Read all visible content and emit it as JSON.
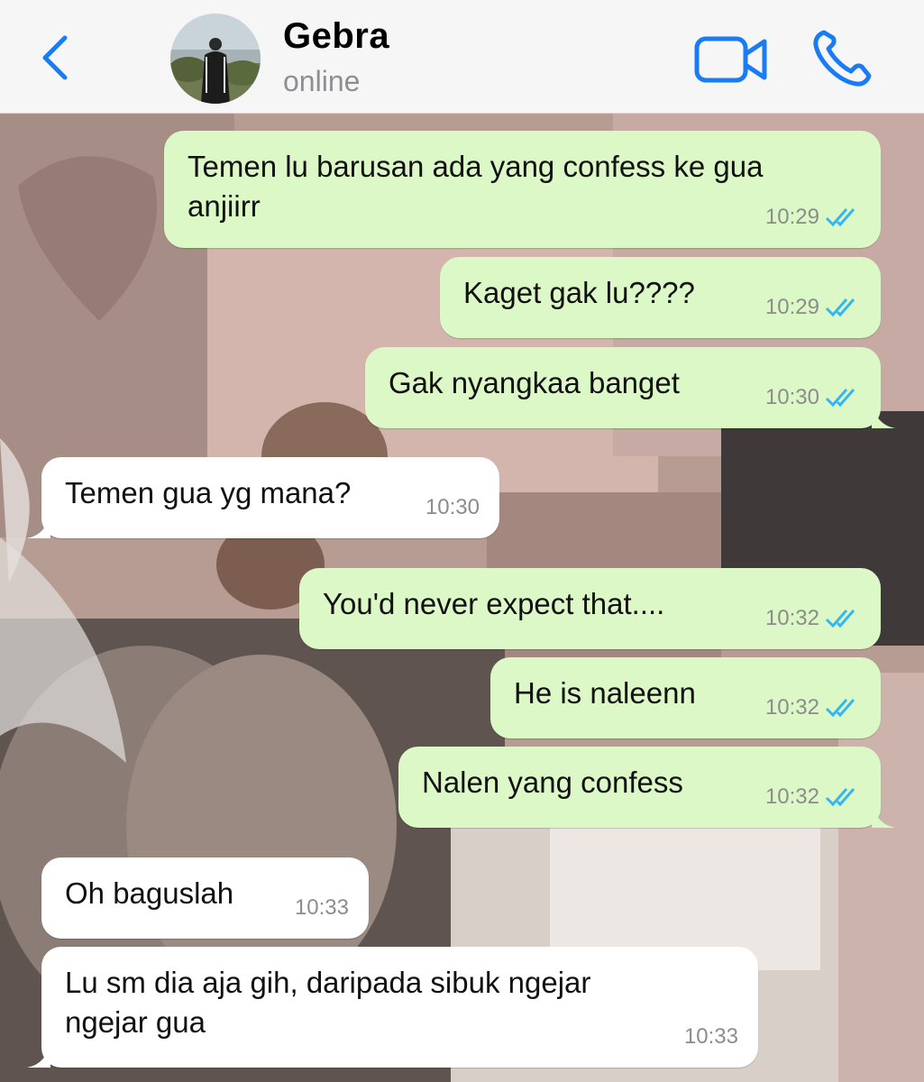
{
  "header": {
    "contact_name": "Gebra",
    "status": "online",
    "accent_color": "#1a7cf5"
  },
  "icons": {
    "back": "chevron-left-icon",
    "video": "video-camera-icon",
    "call": "phone-icon",
    "read": "double-check-icon"
  },
  "colors": {
    "outgoing_bubble": "#dcf8c6",
    "incoming_bubble": "#ffffff",
    "read_ticks": "#34b7f1"
  },
  "messages": [
    {
      "direction": "out",
      "lines": [
        "Temen lu barusan ada yang confess ke gua",
        "anjiirr"
      ],
      "time": "10:29",
      "status": "read"
    },
    {
      "direction": "out",
      "lines": [
        "Kaget gak lu????"
      ],
      "time": "10:29",
      "status": "read"
    },
    {
      "direction": "out",
      "lines": [
        "Gak nyangkaa banget"
      ],
      "time": "10:30",
      "status": "read"
    },
    {
      "direction": "in",
      "lines": [
        "Temen gua yg mana?"
      ],
      "time": "10:30"
    },
    {
      "direction": "out",
      "lines": [
        "You'd never expect that...."
      ],
      "time": "10:32",
      "status": "read"
    },
    {
      "direction": "out",
      "lines": [
        "He is naleenn"
      ],
      "time": "10:32",
      "status": "read"
    },
    {
      "direction": "out",
      "lines": [
        "Nalen yang confess"
      ],
      "time": "10:32",
      "status": "read"
    },
    {
      "direction": "in",
      "lines": [
        "Oh baguslah"
      ],
      "time": "10:33"
    },
    {
      "direction": "in",
      "lines": [
        "Lu sm dia aja gih, daripada sibuk ngejar",
        "ngejar gua"
      ],
      "time": "10:33"
    }
  ]
}
